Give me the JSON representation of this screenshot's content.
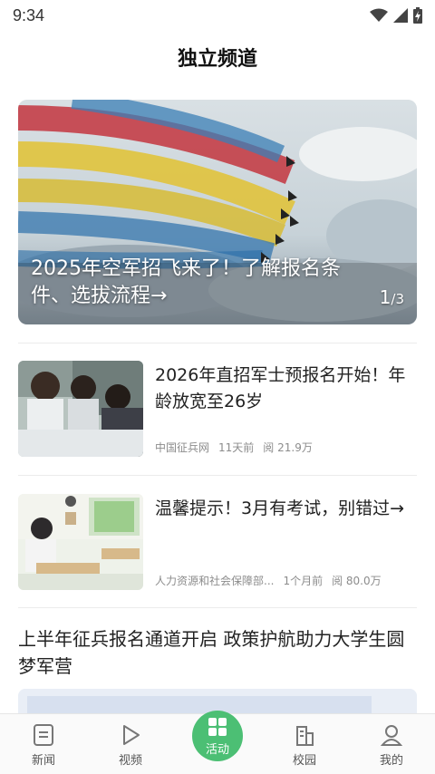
{
  "status": {
    "time": "9:34"
  },
  "header": {
    "title": "独立频道"
  },
  "banner": {
    "caption": "2025年空军招飞来了！了解报名条件、选拔流程→",
    "counter_current": "1",
    "counter_total": "/3"
  },
  "news": [
    {
      "title": "2026年直招军士预报名开始！年龄放宽至26岁",
      "source": "中国征兵网",
      "time": "11天前",
      "reads": "阅 21.9万"
    },
    {
      "title": "温馨提示！3月有考试，别错过→",
      "source": "人力资源和社会保障部...",
      "time": "1个月前",
      "reads": "阅 80.0万"
    }
  ],
  "headline": {
    "title": "上半年征兵报名通道开启 政策护航助力大学生圆梦军营"
  },
  "tabbar": {
    "items": [
      {
        "label": "新闻",
        "icon": "news-icon"
      },
      {
        "label": "视频",
        "icon": "video-icon"
      },
      {
        "label": "活动",
        "icon": "activity-icon"
      },
      {
        "label": "校园",
        "icon": "campus-icon"
      },
      {
        "label": "我的",
        "icon": "profile-icon"
      }
    ],
    "active_color": "#4cbf74"
  }
}
